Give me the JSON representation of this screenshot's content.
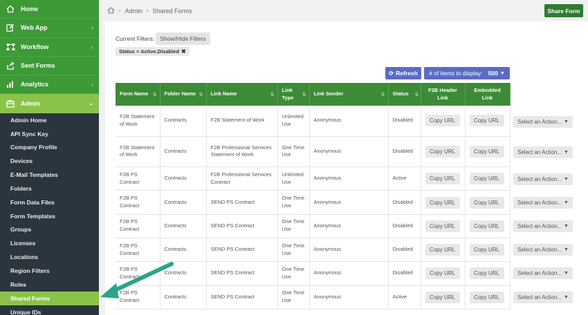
{
  "sidebar": {
    "top_items": [
      {
        "label": "Home",
        "icon": "home-icon",
        "chev": false
      },
      {
        "label": "Web App",
        "icon": "edit-icon",
        "chev": true
      },
      {
        "label": "Workflow",
        "icon": "workflow-icon",
        "chev": true
      },
      {
        "label": "Sent Forms",
        "icon": "share-icon",
        "chev": false
      },
      {
        "label": "Analytics",
        "icon": "bar-chart-icon",
        "chev": true
      },
      {
        "label": "Admin",
        "icon": "briefcase-icon",
        "chev": true
      }
    ],
    "sub_items": [
      "Admin Home",
      "API Sync Key",
      "Company Profile",
      "Devices",
      "E-Mail Templates",
      "Folders",
      "Form Data Files",
      "Form Templates",
      "Groups",
      "Licenses",
      "Locations",
      "Region Filters",
      "Roles",
      "Shared Forms",
      "Unique IDs"
    ],
    "active_sub": "Shared Forms"
  },
  "breadcrumb": {
    "home_icon": "home-icon",
    "items": [
      "Admin",
      "Shared Forms"
    ]
  },
  "header": {
    "share_button": "Share Form"
  },
  "filters": {
    "label": "Current Filters:",
    "toggle_button": "Show/Hide Filters",
    "chip": "Status = Active,Disabled"
  },
  "toolbar": {
    "refresh": "Refresh",
    "items_label": "# of items to display:",
    "items_value": "500"
  },
  "table": {
    "columns": [
      "Form Name",
      "Folder Name",
      "Link Name",
      "Link Type",
      "Link Sender",
      "Status",
      "F2B Header Link",
      "Embedded Link"
    ],
    "copy_label": "Copy URL",
    "action_label": "Select an Action...",
    "rows": [
      {
        "form": "F2B Statement of Work",
        "folder": "Contracts",
        "link": "F2B Statement of Work",
        "type": "Unlimited Use",
        "sender": "Anonymous",
        "status": "Disabled"
      },
      {
        "form": "F2B Statement of Work",
        "folder": "Contracts",
        "link": "F2B Professional Services Statement of Work",
        "type": "One Time Use",
        "sender": "Anonymous",
        "status": "Disabled"
      },
      {
        "form": "F2B PS Contract",
        "folder": "Contracts",
        "link": "F2B Professional Services Contract",
        "type": "Unlimited Use",
        "sender": "Anonymous",
        "status": "Active"
      },
      {
        "form": "F2B PS Contract",
        "folder": "Contracts",
        "link": "SEND PS Contract",
        "type": "One Time Use",
        "sender": "Anonymous",
        "status": "Disabled"
      },
      {
        "form": "F2B PS Contract",
        "folder": "Contracts",
        "link": "SEND PS Contract",
        "type": "One Time Use",
        "sender": "Anonymous",
        "status": "Disabled"
      },
      {
        "form": "F2B PS Contract",
        "folder": "Contracts",
        "link": "SEND PS Contract",
        "type": "One Time Use",
        "sender": "Anonymous",
        "status": "Disabled"
      },
      {
        "form": "F2B PS Contract",
        "folder": "Contracts",
        "link": "SEND PS Contract",
        "type": "One Time Use",
        "sender": "Anonymous",
        "status": "Disabled"
      },
      {
        "form": "F2B PS Contract",
        "folder": "Contracts",
        "link": "SEND PS Contract",
        "type": "One Time Use",
        "sender": "Anonymous",
        "status": "Active"
      }
    ]
  },
  "colors": {
    "nav_green": "#3d9a37",
    "active_green": "#8bc34a",
    "sidebar_dark": "#2b353e",
    "button_blue": "#5a6cc4",
    "arrow": "#2aa58a"
  }
}
